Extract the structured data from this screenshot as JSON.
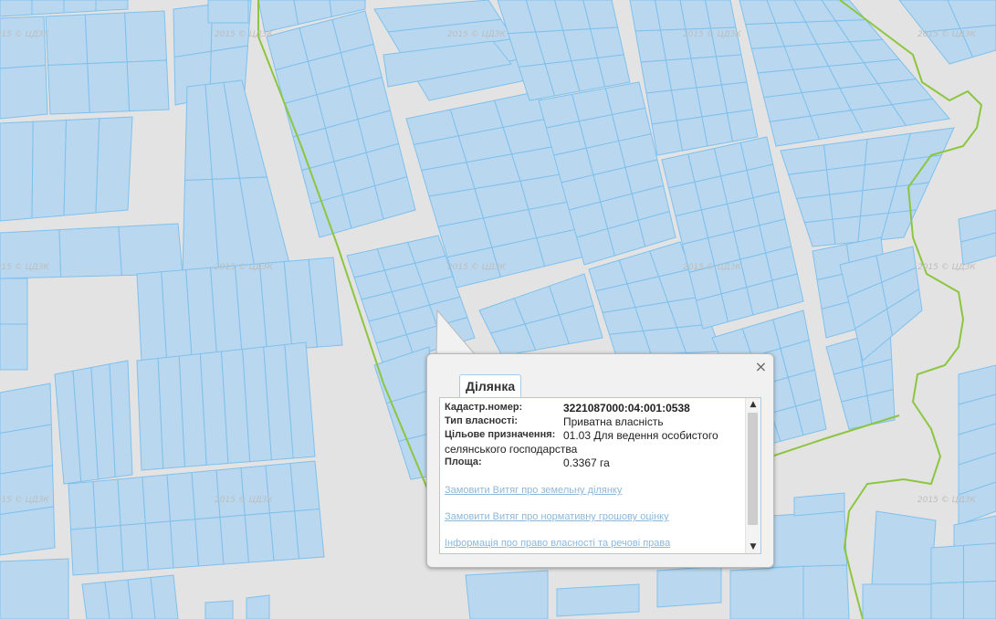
{
  "map": {
    "watermark": "2015 © ЦДЗК",
    "colors": {
      "background": "#e3e3e3",
      "parcel_fill": "#b9d8ef",
      "parcel_stroke": "#7fc0ec",
      "boundary": "#8cc63f"
    }
  },
  "popup": {
    "tab_label": "Ділянка",
    "close_symbol": "×",
    "fields": [
      {
        "label": "Кадастр.номер:",
        "value": "3221087000:04:001:0538"
      },
      {
        "label": "Тип власності:",
        "value": "Приватна власність"
      },
      {
        "label": "Цільове призначення:",
        "value": "01.03 Для ведення особистого"
      },
      {
        "label": "",
        "value": "селянського господарства"
      },
      {
        "label": "Площа:",
        "value": "0.3367 га"
      }
    ],
    "links": [
      "Замовити Витяг про земельну ділянку",
      "Замовити Витяг про нормативну грошову оцінку",
      "Інформація про право власності та речові права"
    ]
  }
}
